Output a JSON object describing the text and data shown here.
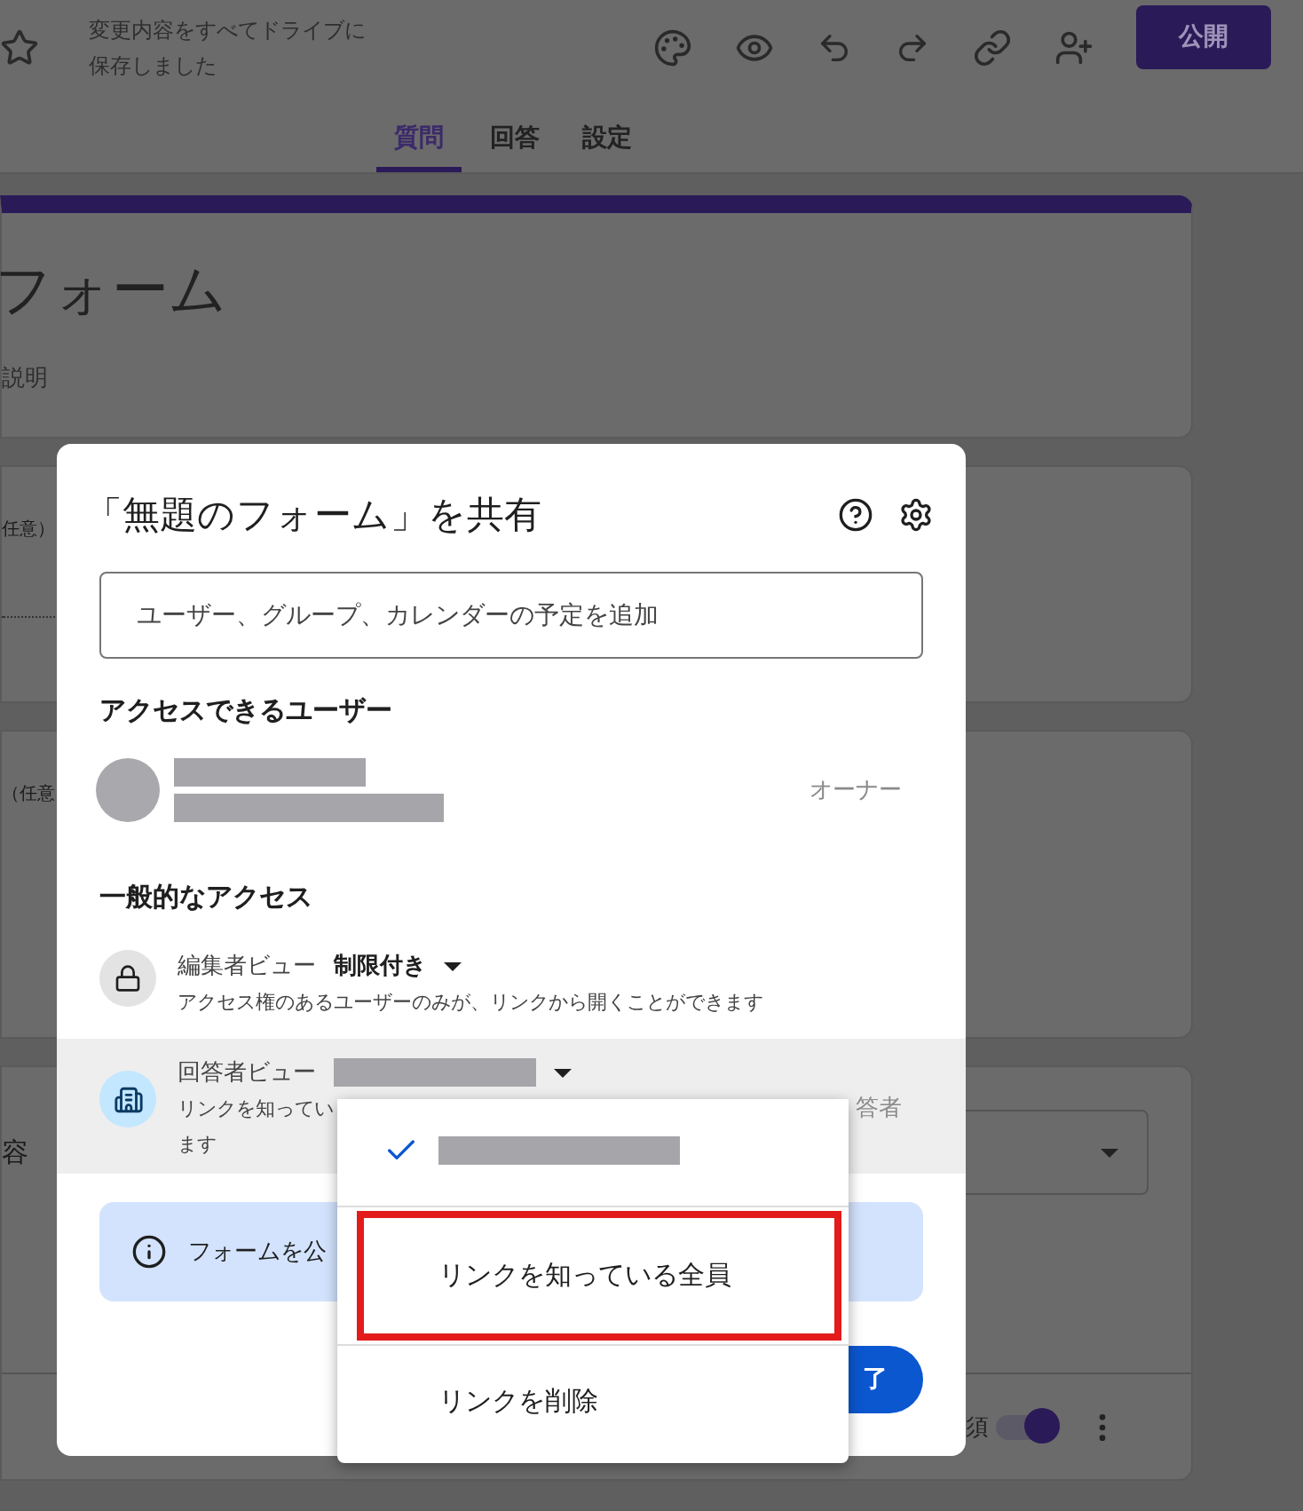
{
  "header": {
    "save_status": "変更内容をすべてドライブに保存しました",
    "publish_button": "公開"
  },
  "tabs": [
    {
      "label": "質問",
      "selected": true
    },
    {
      "label": "回答",
      "selected": false
    },
    {
      "label": "設定",
      "selected": false
    }
  ],
  "form": {
    "title": "フォーム",
    "description": "説明",
    "question_2": "任意）",
    "question_3": "（任意",
    "question_4": "容",
    "required_label": "須",
    "required_on": true
  },
  "dialog": {
    "title": "「無題のフォーム」を共有",
    "input_placeholder": "ユーザー、グループ、カレンダーの予定を追加",
    "people_heading": "アクセスできるユーザー",
    "people": [
      {
        "role": "オーナー"
      }
    ],
    "general_heading": "一般的なアクセス",
    "access_rows": [
      {
        "kind": "editor",
        "label": "編集者ビュー",
        "value": "制限付き",
        "description_lines": [
          "アクセス権のあるユーザーのみが、リンクから開くことができます"
        ],
        "active": false
      },
      {
        "kind": "responder",
        "label": "回答者ビュー",
        "role": "答者",
        "description_lines": [
          "リンクを知ってい",
          "ます"
        ],
        "active": true
      }
    ],
    "banner": "フォームを公",
    "done_button": "了"
  },
  "menu": {
    "items": [
      {
        "kind": "redacted",
        "selected": true,
        "highlighted": false
      },
      {
        "kind": "text",
        "label": "リンクを知っている全員",
        "selected": false,
        "highlighted": true
      },
      {
        "kind": "text",
        "label": "リンクを削除",
        "selected": false,
        "highlighted": false
      }
    ]
  }
}
